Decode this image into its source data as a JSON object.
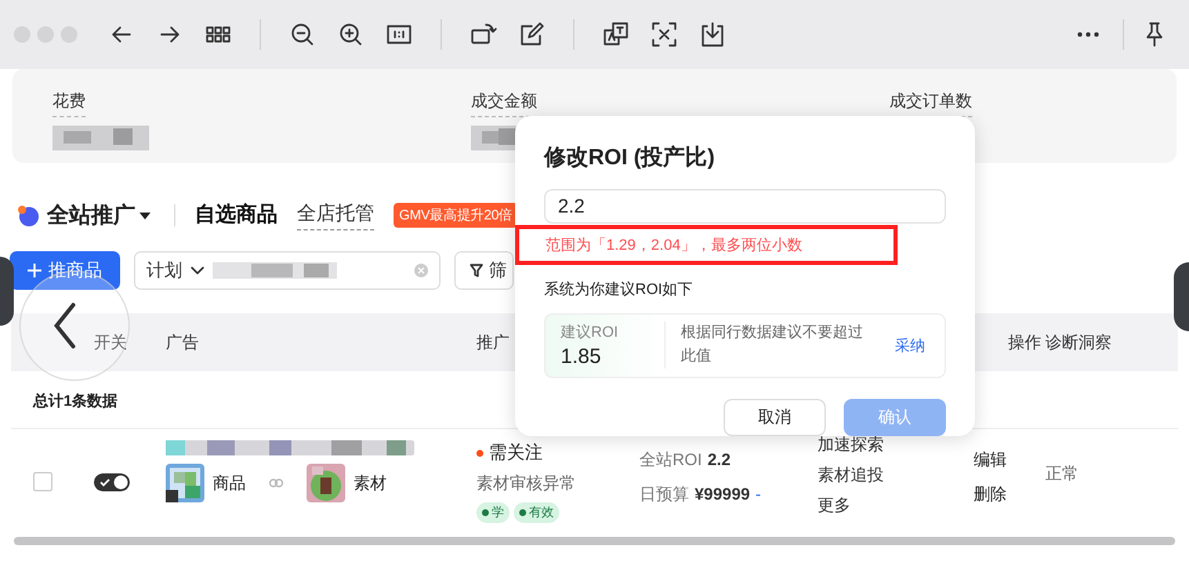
{
  "metrics": [
    {
      "label": "花费"
    },
    {
      "label": "成交金额"
    },
    {
      "label": "成交订单数"
    }
  ],
  "header": {
    "title": "全站推广",
    "tabs": [
      {
        "label": "自选商品",
        "selected": true
      },
      {
        "label": "全店托管",
        "selected": false
      }
    ],
    "badge": "GMV最高提升20倍"
  },
  "actions": {
    "add_button": "推商品",
    "filter_label": "计划",
    "filter_button": "筛"
  },
  "table": {
    "columns": [
      "开关",
      "广告",
      "推广",
      "操作",
      "诊断洞察"
    ],
    "total": "总计1条数据",
    "rows": [
      {
        "selected": false,
        "on": true,
        "product_tag": "商品",
        "material_tag": "素材",
        "status": {
          "label": "需关注",
          "color": "#ff4d1a",
          "detail": "素材审核异常",
          "tags": [
            "学",
            "有效"
          ]
        },
        "roi_label": "全站ROI",
        "roi": "2.2",
        "budget_label": "日预算",
        "budget": "¥99999",
        "budget_suffix": "-",
        "more_actions": [
          "加速探索",
          "素材追投",
          "更多"
        ],
        "ops": [
          "编辑",
          "删除"
        ],
        "diagnosis": "正常"
      }
    ]
  },
  "dialog": {
    "title": "修改ROI (投产比)",
    "value": "2.2",
    "error": "范围为「1.29，2.04」，最多两位小数",
    "section": "系统为你建议ROI如下",
    "suggestion": {
      "label": "建议ROI",
      "value": "1.85",
      "note": "根据同行数据建议不要超过此值",
      "action": "采纳"
    },
    "cancel": "取消",
    "confirm": "确认",
    "confirm_disabled": true
  }
}
